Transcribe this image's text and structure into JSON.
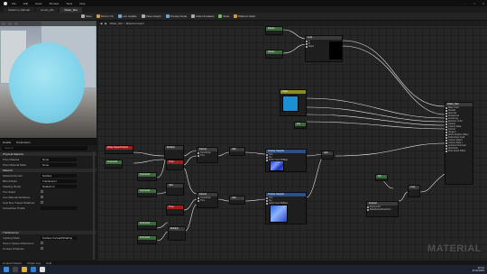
{
  "window": {
    "tabs": [
      {
        "label": "Kanlicom_Manual"
      },
      {
        "label": "Lonely_Ms"
      },
      {
        "label": "Water_Mer"
      }
    ],
    "menu": [
      "File",
      "Edit",
      "Asset",
      "Window",
      "Tools",
      "Help"
    ]
  },
  "toolbar": {
    "items": [
      {
        "label": "Save",
        "icon": "save-icon"
      },
      {
        "label": "Find in Cb",
        "icon": "browse-icon"
      },
      {
        "label": "Live Update",
        "icon": "refresh-icon"
      },
      {
        "label": "Clean Graph",
        "icon": "clean-icon"
      },
      {
        "label": "Preview Node",
        "icon": "preview-icon"
      },
      {
        "label": "Hide Unrelated",
        "icon": "hide-icon"
      },
      {
        "label": "Stats",
        "icon": "stats-icon"
      },
      {
        "label": "Platform Stats",
        "icon": "platform-icon"
      }
    ]
  },
  "graph": {
    "breadcrumb": "Water_Mer > Material Graph",
    "watermark": "MATERIAL"
  },
  "details": {
    "tabs": [
      "Details",
      "Parameters"
    ],
    "search_placeholder": "Search",
    "sections": [
      {
        "title": "Physical Material"
      },
      {
        "title": "Material"
      },
      {
        "title": "Translucency"
      }
    ],
    "rows": [
      {
        "label": "Phys Material",
        "value": "None"
      },
      {
        "label": "Phys Material Mask",
        "value": "None"
      },
      {
        "label": "Material Domain",
        "value": "Surface"
      },
      {
        "label": "Blend Mode",
        "value": "Translucent"
      },
      {
        "label": "Shading Model",
        "value": "Default Lit"
      },
      {
        "label": "Two Sided",
        "value": ""
      },
      {
        "label": "Use Material Attributes",
        "value": ""
      },
      {
        "label": "Cast Ray Traced Shadows",
        "value": ""
      },
      {
        "label": "Subsurface Profile",
        "value": ""
      },
      {
        "label": "Lighting Mode",
        "value": "Surface ForwardShading"
      },
      {
        "label": "Screen Space Reflections",
        "value": ""
      },
      {
        "label": "Contact Shadows",
        "value": ""
      }
    ]
  },
  "nodes": {
    "output": {
      "title": "Water_Mer",
      "pins": [
        "Base Color",
        "Metallic",
        "Specular",
        "Roughness",
        "Anisotropy",
        "Emissive Color",
        "Opacity",
        "Opacity Mask",
        "Normal",
        "Tangent",
        "World Position Offset",
        "Subsurface Color",
        "Custom Data 0",
        "Custom Data 1",
        "Ambient Occlusion",
        "Refraction",
        "Pixel Depth Offset"
      ]
    },
    "param_a": {
      "title": "Param"
    },
    "param_b": {
      "title": "Param"
    },
    "lerp": {
      "title": "Lerp",
      "pins": [
        "A",
        "B",
        "Alpha"
      ]
    },
    "vector": {
      "title": "Color"
    },
    "rough": {
      "title": "0.9"
    },
    "texsample_a": {
      "title": "Texture Sample",
      "pins": [
        "UVs",
        "Tex",
        "Apply View MipBias"
      ]
    },
    "texsample_b": {
      "title": "Texture Sample",
      "pins": [
        "UVs",
        "Tex",
        "Apply View MipBias"
      ]
    },
    "scalar_red": {
      "title": "Wave Speed Param"
    },
    "time_a": {
      "title": "Time"
    },
    "time_b": {
      "title": "Time"
    },
    "panner_a": {
      "title": "Panner",
      "pins": [
        "Coordinate",
        "Time",
        "Speed"
      ]
    },
    "panner_b": {
      "title": "Panner",
      "pins": [
        "Coordinate",
        "Time",
        "Speed"
      ]
    },
    "multiply": {
      "title": "Multiply"
    },
    "add": {
      "title": "Add"
    },
    "fresnel": {
      "title": "Fresnel",
      "pins": [
        "ExponentIn",
        "BaseReflectFractionIn",
        "Normal"
      ]
    },
    "coord_a": {
      "title": "TexCoord"
    },
    "coord_b": {
      "title": "TexCoord"
    }
  },
  "statusbar": {
    "items": [
      "Content Drawer",
      "Output Log",
      "Cmd"
    ]
  },
  "taskbar": {
    "time": "10:24",
    "date": "2/13/2025"
  }
}
